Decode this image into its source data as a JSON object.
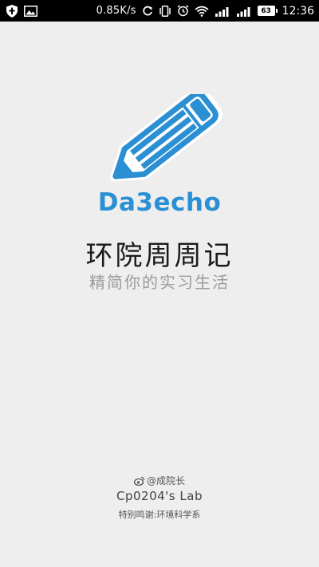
{
  "status_bar": {
    "net_speed": "0.85K/s",
    "battery_level": "63",
    "clock": "12:36",
    "icons": [
      "shield-icon",
      "image-icon",
      "sync-icon",
      "vibrate-icon",
      "alarm-icon",
      "wifi-icon",
      "signal-icon",
      "signal-icon",
      "battery-icon"
    ]
  },
  "splash": {
    "brand": "Da3echo",
    "app_title": "环院周周记",
    "slogan": "精简你的实习生活",
    "brand_color": "#2b8fd3"
  },
  "footer": {
    "weibo": "@成院长",
    "lab": "Cp0204's Lab",
    "thanks": "特别鸣谢:环境科学系"
  }
}
